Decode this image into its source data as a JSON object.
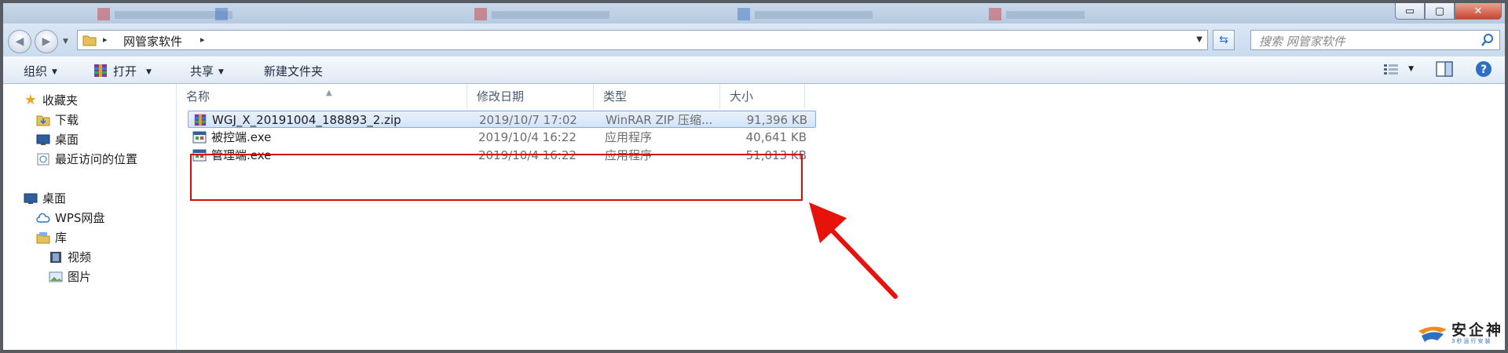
{
  "window": {
    "controls": {
      "minimize": "▭",
      "maximize": "▢",
      "close": "✕"
    }
  },
  "address_bar": {
    "current_folder": "网管家软件",
    "separator": "▸"
  },
  "search": {
    "placeholder": "搜索 网管家软件"
  },
  "toolbar": {
    "organize": "组织",
    "open": "打开",
    "share": "共享",
    "new_folder": "新建文件夹"
  },
  "sidebar": {
    "favorites": "收藏夹",
    "downloads": "下载",
    "desktop": "桌面",
    "recent": "最近访问的位置",
    "desktop_root": "桌面",
    "wps": "WPS网盘",
    "library": "库",
    "video": "视频",
    "pictures": "图片"
  },
  "columns": {
    "name": "名称",
    "modified": "修改日期",
    "type": "类型",
    "size": "大小"
  },
  "files": [
    {
      "name": "WGJ_X_20191004_188893_2.zip",
      "modified": "2019/10/7 17:02",
      "type": "WinRAR ZIP 压缩...",
      "size": "91,396 KB",
      "icon": "winrar-archive-icon"
    },
    {
      "name": "被控端.exe",
      "modified": "2019/10/4 16:22",
      "type": "应用程序",
      "size": "40,641 KB",
      "icon": "application-icon"
    },
    {
      "name": "管理端.exe",
      "modified": "2019/10/4 16:22",
      "type": "应用程序",
      "size": "51,013 KB",
      "icon": "application-icon"
    }
  ],
  "watermark": {
    "brand": "安企神",
    "tagline": "3秒运行安装"
  },
  "colors": {
    "highlight_box": "#d00d0d",
    "selection": "#d3e4f7",
    "accent": "#2d6fc3"
  }
}
